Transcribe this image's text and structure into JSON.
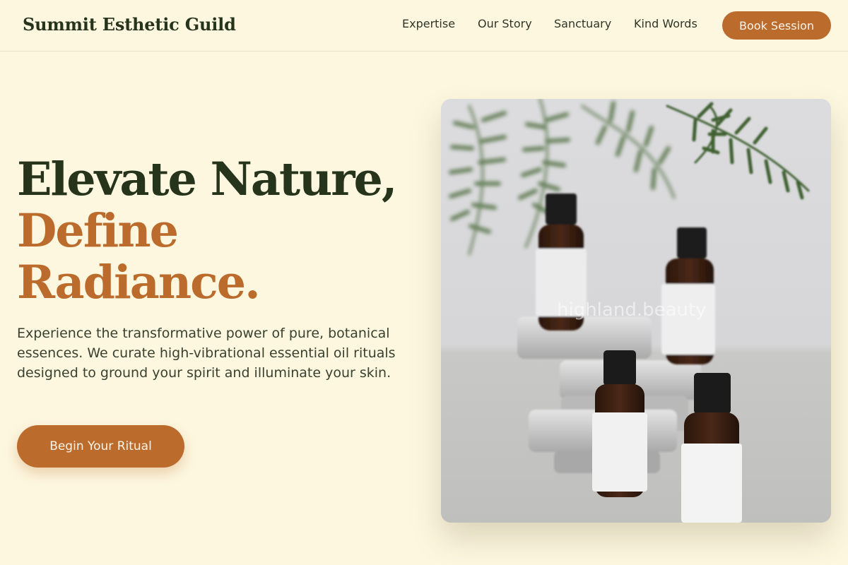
{
  "brand": {
    "name": "Summit Esthetic Guild"
  },
  "nav": {
    "items": [
      {
        "label": "Expertise"
      },
      {
        "label": "Our Story"
      },
      {
        "label": "Sanctuary"
      },
      {
        "label": "Kind Words"
      }
    ],
    "cta_label": "Book Session"
  },
  "hero": {
    "title_line1": "Elevate Nature,",
    "title_line2": "Define",
    "title_line3": "Radiance.",
    "description": "Experience the transformative power of pure, botanical essences. We curate high-vibrational essential oil rituals designed to ground your spirit and illuminate your skin.",
    "cta_label": "Begin Your Ritual",
    "image": {
      "subject": "amber essential oil bottles with white labels on metal tins beside fern leaves",
      "watermark": "highland.beauty"
    }
  },
  "colors": {
    "background": "#fdf7df",
    "accent": "#bb6b2c",
    "dark_green": "#27341c",
    "text": "#39402f"
  }
}
